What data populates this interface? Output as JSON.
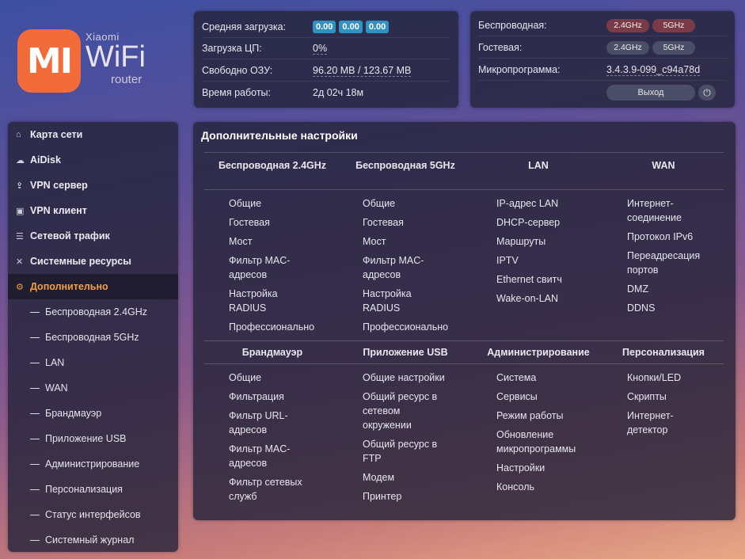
{
  "logo": {
    "mark": "MI",
    "brand": "Xiaomi",
    "product": "WiFi",
    "sub": "router"
  },
  "status": {
    "cpu_load_label": "Средняя загрузка:",
    "cpu_load_values": [
      "0.00",
      "0.00",
      "0.00"
    ],
    "cpu_label": "Загрузка ЦП:",
    "cpu_value": "0%",
    "ram_label": "Свободно ОЗУ:",
    "ram_value": "96.20 MB / 123.67 MB",
    "uptime_label": "Время работы:",
    "uptime_value": "2д 02ч 18м"
  },
  "wireless": {
    "wireless_label": "Беспроводная:",
    "guest_label": "Гостевая:",
    "band_24": "2.4GHz",
    "band_5": "5GHz",
    "firmware_label": "Микропрограмма:",
    "firmware_value": "3.4.3.9-099_c94a78d",
    "logout_label": "Выход",
    "colors": {
      "off_pill": "#7a3a48",
      "on_pill": "#4a4e66"
    }
  },
  "sidebar": {
    "items": [
      {
        "label": "Карта сети",
        "icon": "home-icon"
      },
      {
        "label": "AiDisk",
        "icon": "cloud-icon"
      },
      {
        "label": "VPN сервер",
        "icon": "share-icon"
      },
      {
        "label": "VPN клиент",
        "icon": "lock-icon"
      },
      {
        "label": "Сетевой трафик",
        "icon": "list-icon"
      },
      {
        "label": "Системные ресурсы",
        "icon": "shuffle-icon"
      },
      {
        "label": "Дополнительно",
        "icon": "gear-icon"
      }
    ],
    "subitems": [
      "Беспроводная 2.4GHz",
      "Беспроводная 5GHz",
      "LAN",
      "WAN",
      "Брандмауэр",
      "Приложение USB",
      "Администрирование",
      "Персонализация",
      "Статус интерфейсов",
      "Системный журнал"
    ],
    "active_color": "#f2a040"
  },
  "main": {
    "title": "Дополнительные настройки",
    "sections_top": [
      {
        "heading": "Беспроводная 2.4GHz",
        "links": [
          "Общие",
          "Гостевая",
          "Мост",
          "Фильтр MAC-адресов",
          "Настройка RADIUS",
          "Профессионально"
        ]
      },
      {
        "heading": "Беспроводная 5GHz",
        "links": [
          "Общие",
          "Гостевая",
          "Мост",
          "Фильтр MAC-адресов",
          "Настройка RADIUS",
          "Профессионально"
        ]
      },
      {
        "heading": "LAN",
        "links": [
          "IP-адрес LAN",
          "DHCP-сервер",
          "Маршруты",
          "IPTV",
          "Ethernet свитч",
          "Wake-on-LAN"
        ]
      },
      {
        "heading": "WAN",
        "links": [
          "Интернет-соединение",
          "Протокол IPv6",
          "Переадресация портов",
          "DMZ",
          "DDNS"
        ]
      }
    ],
    "sections_bottom": [
      {
        "heading": "Брандмауэр",
        "links": [
          "Общие",
          "Фильтрация",
          "Фильтр URL-адресов",
          "Фильтр MAC-адресов",
          "Фильтр сетевых служб"
        ]
      },
      {
        "heading": "Приложение USB",
        "links": [
          "Общие настройки",
          "Общий ресурс в сетевом окружении",
          "Общий ресурс в FTP",
          "Модем",
          "Принтер"
        ]
      },
      {
        "heading": "Администрирование",
        "links": [
          "Система",
          "Сервисы",
          "Режим работы",
          "Обновление микропрограммы",
          "Настройки",
          "Консоль"
        ]
      },
      {
        "heading": "Персонализация",
        "links": [
          "Кнопки/LED",
          "Скрипты",
          "Интернет-детектор"
        ]
      }
    ]
  }
}
